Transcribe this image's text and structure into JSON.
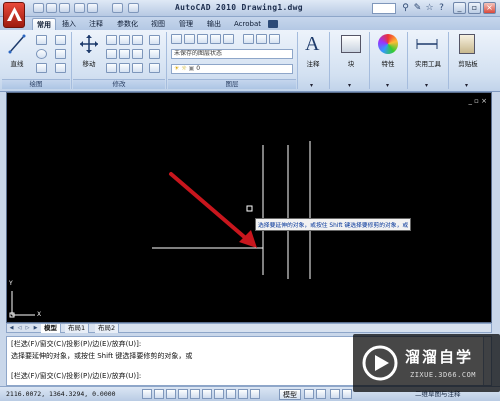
{
  "window": {
    "title": "AutoCAD 2010  Drawing1.dwg"
  },
  "ribbon_tabs": [
    "常用",
    "插入",
    "注释",
    "参数化",
    "视图",
    "管理",
    "输出",
    "Acrobat"
  ],
  "ribbon": {
    "draw": {
      "line_label": "直线",
      "panel_label": "绘图"
    },
    "modify": {
      "move_label": "移动",
      "panel_label": "修改"
    },
    "layers": {
      "layer_state": "未保存的图层状态",
      "layer_current": "0",
      "panel_label": "图层"
    },
    "annotation": {
      "label": "注释"
    },
    "block": {
      "label": "块"
    },
    "properties": {
      "label": "特性"
    },
    "utilities": {
      "label": "实用工具"
    },
    "clipboard": {
      "label": "剪贴板"
    }
  },
  "canvas": {
    "tooltip": "选择要延伸的对象，或按住 Shift 键选择要修剪的对象，或",
    "ucs_y": "Y",
    "ucs_x": "X",
    "viewport_controls": "_ ▫ ×"
  },
  "layout_tabs": [
    "模型",
    "布局1",
    "布局2"
  ],
  "command_lines": [
    "[栏选(F)/窗交(C)/投影(P)/边(E)/放弃(U)]:",
    "选择要延伸的对象，或按住 Shift 键选择要修剪的对象，或",
    "[栏选(F)/窗交(C)/投影(P)/边(E)/放弃(U)]:"
  ],
  "statusbar": {
    "coords": "2116.0072, 1364.3294, 0.0000",
    "model_label": "模型",
    "workspace": "二维草图与注释"
  },
  "watermark": {
    "title": "溜溜自学",
    "subtitle": "ZIXUE.3D66.COM"
  },
  "colors": {
    "canvas_bg": "#000000",
    "arrow": "#c8161d",
    "lines": "#ffffff",
    "ribbon_bg": "#dbe6f4"
  }
}
